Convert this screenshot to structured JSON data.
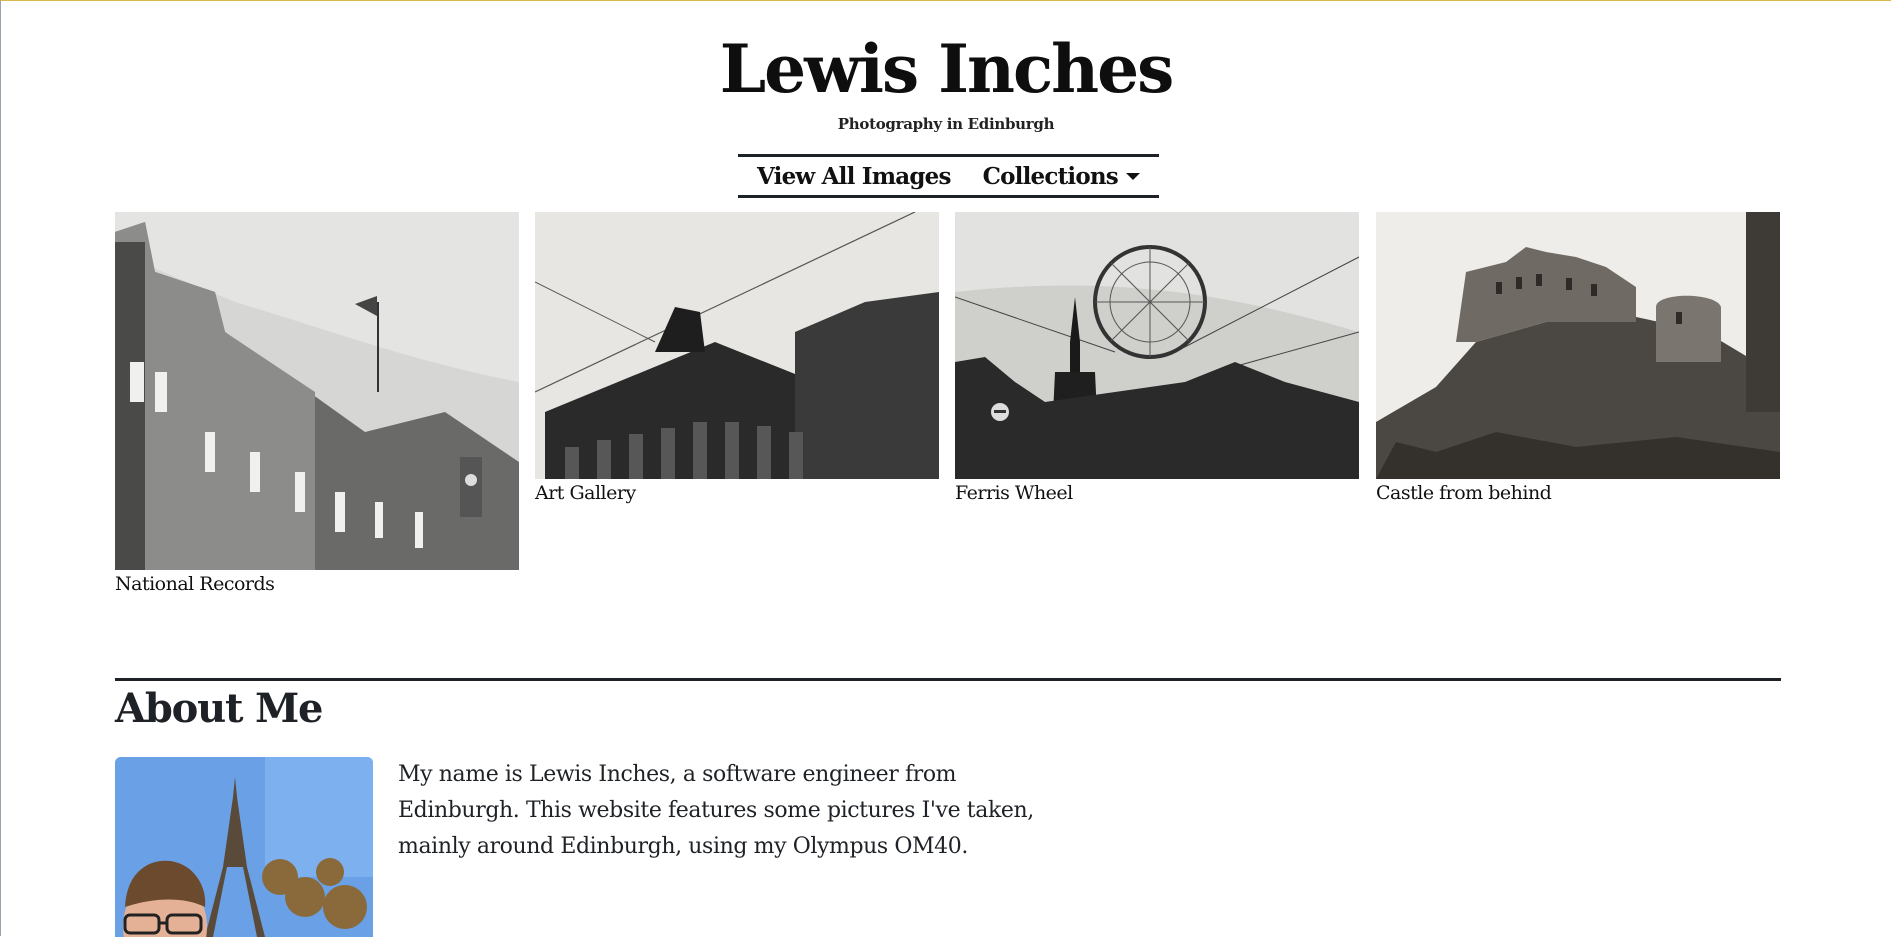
{
  "site": {
    "title": "Lewis Inches",
    "subtitle": "Photography in Edinburgh"
  },
  "nav": {
    "items": [
      {
        "label": "View All Images",
        "icon": null
      },
      {
        "label": "Collections",
        "icon": "caret-down-icon"
      }
    ]
  },
  "gallery": {
    "items": [
      {
        "caption": "National Records",
        "icon": "photo-national-records"
      },
      {
        "caption": "Art Gallery",
        "icon": "photo-art-gallery"
      },
      {
        "caption": "Ferris Wheel",
        "icon": "photo-ferris-wheel"
      },
      {
        "caption": "Castle from behind",
        "icon": "photo-castle"
      }
    ]
  },
  "about": {
    "heading": "About Me",
    "text": "My name is Lewis Inches, a software engineer from Edinburgh. This website features some pictures I've taken, mainly around Edinburgh, using my Olympus OM40."
  },
  "colors": {
    "text": "#1e2226",
    "background": "#ffffff",
    "sky": "#6aa1e6"
  }
}
